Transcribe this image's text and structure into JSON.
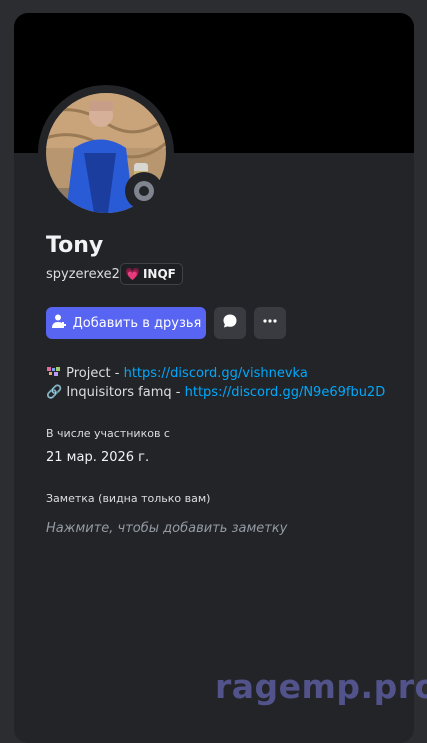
{
  "profile": {
    "display_name": "Tony",
    "username": "spyzerexe2",
    "tag": {
      "heart": "💗",
      "label": "INQF"
    },
    "status": "offline"
  },
  "actions": {
    "add_friend_label": "Добавить в друзья",
    "message_icon": "chat-bubble-icon",
    "more_icon": "more-dots-icon"
  },
  "bio": {
    "line1_text": " Project - ",
    "line1_link": "https://discord.gg/vishnevka",
    "line2_emoji": "🔗",
    "line2_text": " Inquisitors famq - ",
    "line2_link": "https://discord.gg/N9e69fbu2D"
  },
  "member_since": {
    "title": "В числе участников с",
    "date": "21 мар. 2026 г."
  },
  "note": {
    "title": "Заметка (видна только вам)",
    "placeholder": "Нажмите, чтобы добавить заметку"
  },
  "watermark": "ragemp.pro",
  "colors": {
    "accent": "#5865f2",
    "link": "#00a8fc",
    "card_bg": "#232428",
    "banner": "#000000"
  }
}
